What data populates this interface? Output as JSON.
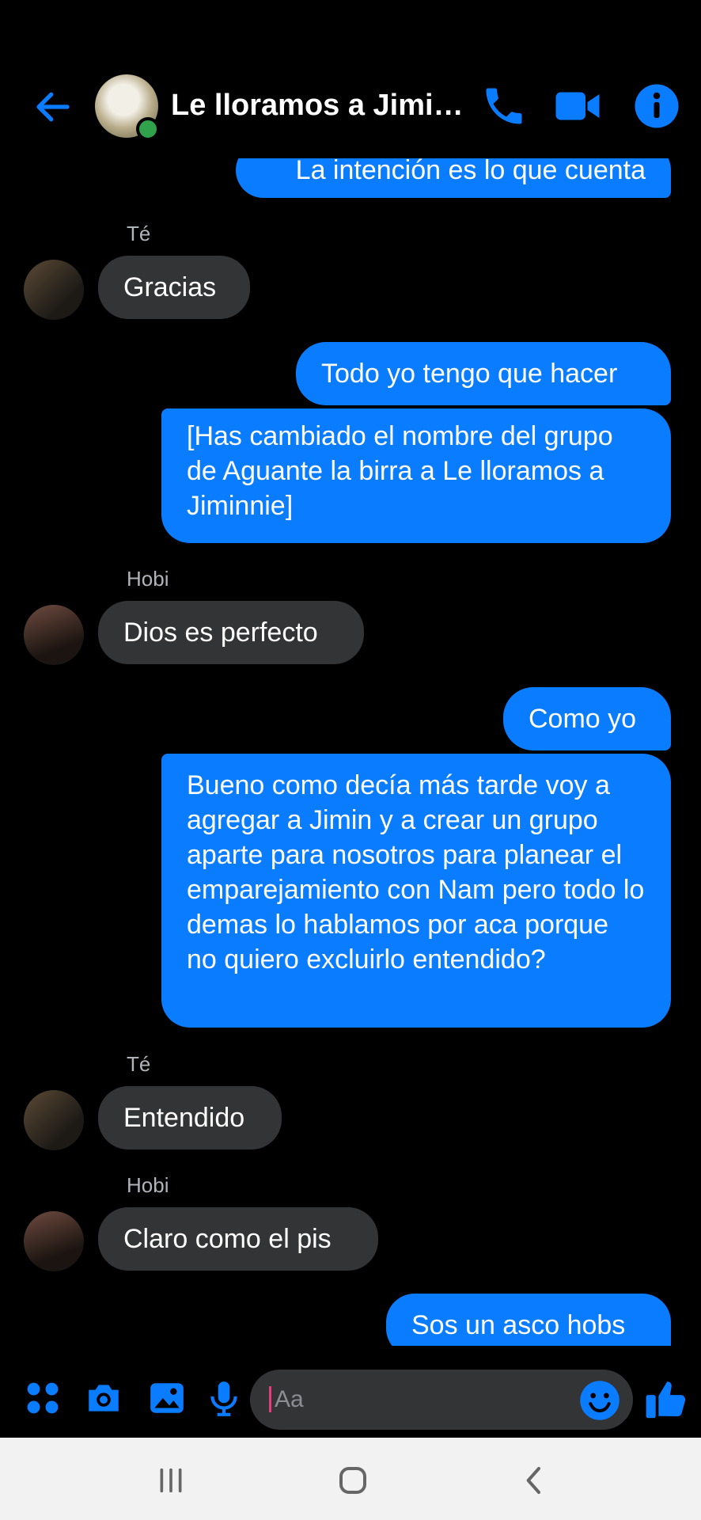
{
  "header": {
    "title": "Le lloramos a Jimi…"
  },
  "messages": [
    {
      "type": "out",
      "text": "La intención es lo que cuenta"
    },
    {
      "type": "in",
      "sender": "Té",
      "text": "Gracias"
    },
    {
      "type": "out",
      "text": "Todo yo tengo que hacer"
    },
    {
      "type": "out",
      "text": "[Has cambiado el nombre del grupo de Aguante la birra a Le lloramos a Jiminnie]"
    },
    {
      "type": "in",
      "sender": "Hobi",
      "text": "Dios es perfecto"
    },
    {
      "type": "out",
      "text": "Como yo"
    },
    {
      "type": "out",
      "text": "Bueno como decía más tarde voy a agregar a Jimin y a crear un grupo aparte para nosotros para planear el emparejamiento con Nam pero todo lo demas lo hablamos por aca porque no quiero excluirlo entendido?"
    },
    {
      "type": "in",
      "sender": "Té",
      "text": "Entendido"
    },
    {
      "type": "in",
      "sender": "Hobi",
      "text": "Claro como el pis"
    },
    {
      "type": "out",
      "text": "Sos un asco hobs"
    }
  ],
  "composer": {
    "placeholder": "Aa"
  },
  "icons": [
    "back-arrow-icon",
    "phone-icon",
    "video-camera-icon",
    "info-icon",
    "apps-grid-icon",
    "camera-icon",
    "image-icon",
    "microphone-icon",
    "emoji-icon",
    "thumbs-up-icon",
    "recent-apps-icon",
    "home-icon",
    "back-icon"
  ],
  "colors": {
    "accent": "#0a7cff",
    "incoming_bubble": "#333436",
    "background": "#000000",
    "online": "#31a24c"
  }
}
